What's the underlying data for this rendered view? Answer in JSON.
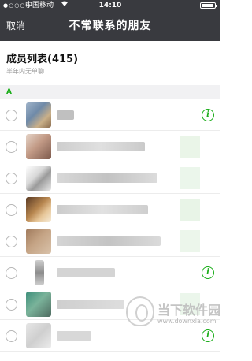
{
  "status_bar": {
    "signal": "●○○○○",
    "carrier": "中国移动",
    "wifi_icon": "wifi-icon",
    "time": "14:10",
    "battery_icon": "battery-icon"
  },
  "nav": {
    "cancel_label": "取消",
    "title": "不常联系的朋友"
  },
  "summary": {
    "count_label": "成员列表(415)",
    "subtitle": "半年内无单聊"
  },
  "section": {
    "letter": "A"
  },
  "rows": [
    {
      "info_glyph": "i",
      "has_info": true
    },
    {
      "info_glyph": "",
      "has_info": false
    },
    {
      "info_glyph": "",
      "has_info": false
    },
    {
      "info_glyph": "",
      "has_info": false
    },
    {
      "info_glyph": "",
      "has_info": false
    },
    {
      "info_glyph": "i",
      "has_info": true
    },
    {
      "info_glyph": "",
      "has_info": false
    },
    {
      "info_glyph": "i",
      "has_info": true
    }
  ],
  "watermark": {
    "brand": "当下软件园",
    "url": "www.downxia.com"
  },
  "colors": {
    "nav_bg": "#393a3f",
    "accent_green": "#1aad19",
    "section_bg": "#f1f1f3"
  }
}
